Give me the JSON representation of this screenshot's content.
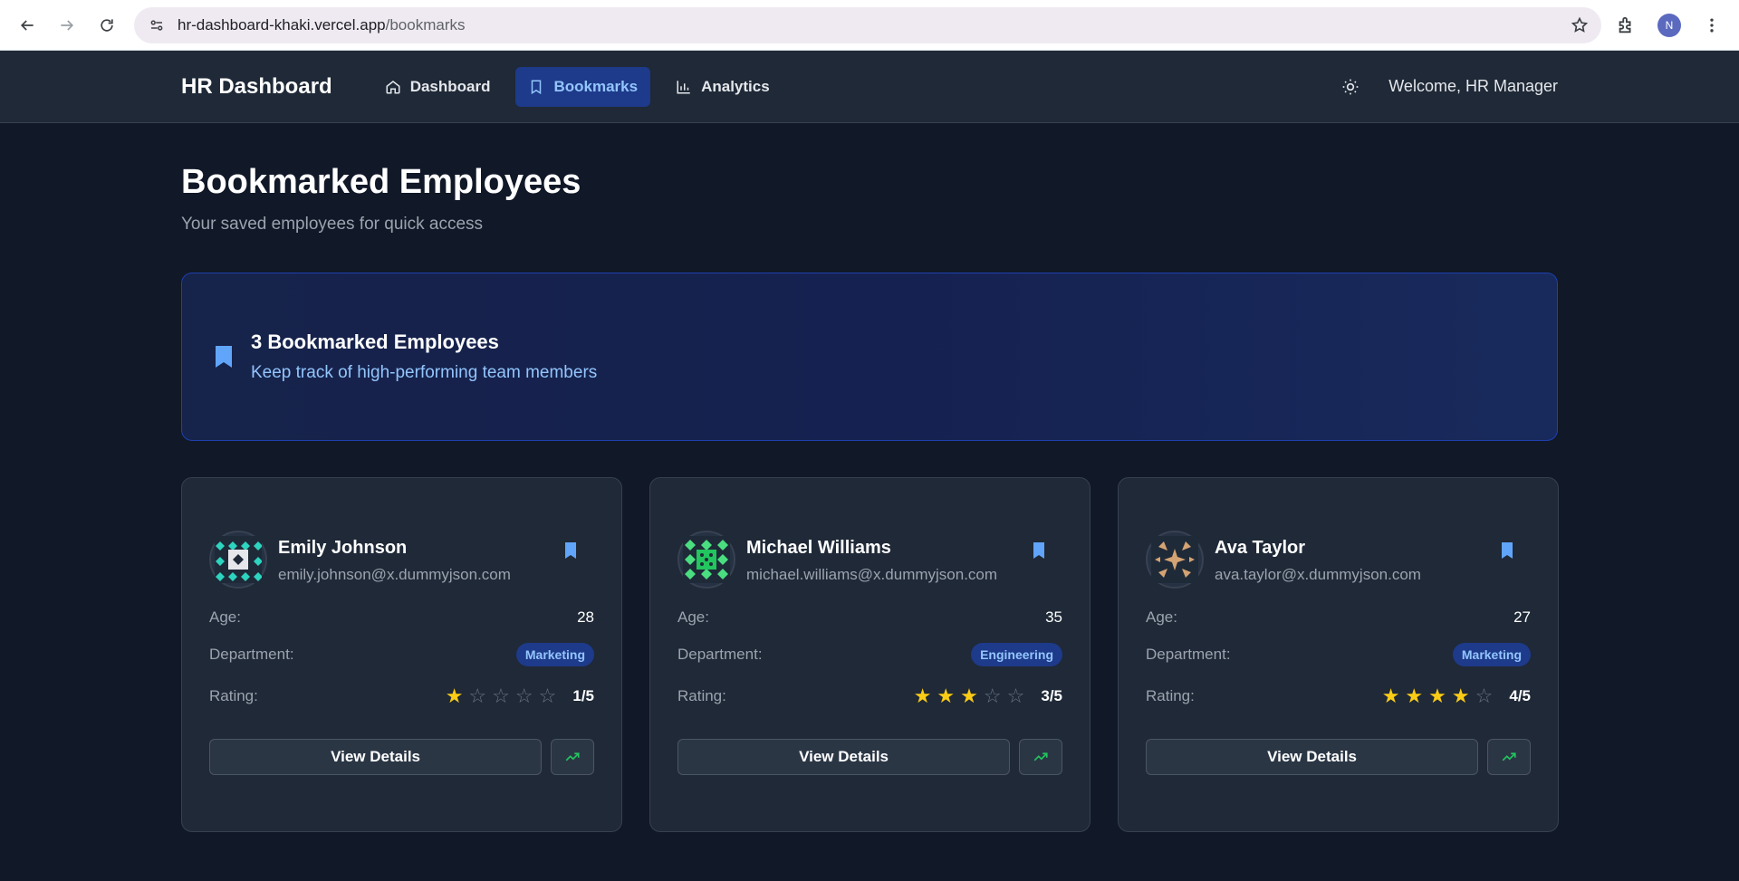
{
  "browser": {
    "url_host": "hr-dashboard-khaki.vercel.app",
    "url_path": "/bookmarks",
    "profile_initial": "N"
  },
  "header": {
    "brand": "HR Dashboard",
    "nav": [
      {
        "label": "Dashboard",
        "icon": "home-icon",
        "active": false
      },
      {
        "label": "Bookmarks",
        "icon": "bookmark-icon",
        "active": true
      },
      {
        "label": "Analytics",
        "icon": "bar-chart-icon",
        "active": false
      }
    ],
    "welcome": "Welcome, HR Manager"
  },
  "page": {
    "title": "Bookmarked Employees",
    "subtitle": "Your saved employees for quick access"
  },
  "summary": {
    "title": "3 Bookmarked Employees",
    "subtitle": "Keep track of high-performing team members"
  },
  "labels": {
    "age": "Age:",
    "department": "Department:",
    "rating": "Rating:",
    "view_details": "View Details"
  },
  "employees": [
    {
      "name": "Emily Johnson",
      "email": "emily.johnson@x.dummyjson.com",
      "age": "28",
      "department": "Marketing",
      "rating": 1,
      "rating_text": "1/5",
      "avatar": "teal-diamond-pattern"
    },
    {
      "name": "Michael Williams",
      "email": "michael.williams@x.dummyjson.com",
      "age": "35",
      "department": "Engineering",
      "rating": 3,
      "rating_text": "3/5",
      "avatar": "green-dot-pattern"
    },
    {
      "name": "Ava Taylor",
      "email": "ava.taylor@x.dummyjson.com",
      "age": "27",
      "department": "Marketing",
      "rating": 4,
      "rating_text": "4/5",
      "avatar": "tan-star-pattern"
    }
  ],
  "colors": {
    "accent": "#60a5fa",
    "star": "#facc15",
    "trend": "#22c55e",
    "background": "#111827"
  }
}
